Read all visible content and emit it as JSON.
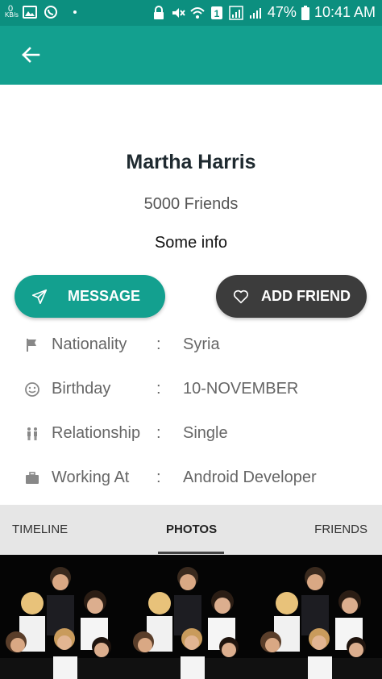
{
  "status_bar": {
    "kbs_top": "0",
    "kbs_bottom": "KB/s",
    "battery": "47%",
    "time": "10:41 AM",
    "icons": [
      "image-icon",
      "whatsapp-icon",
      "dot-icon",
      "lock-icon",
      "mute-icon",
      "wifi-icon",
      "sim-icon",
      "signal-icon",
      "battery-icon"
    ]
  },
  "app_bar": {
    "back_icon": "arrow-left-icon",
    "color": "#13a08f",
    "status_color": "#0c8f7f"
  },
  "profile": {
    "name": "Martha Harris",
    "friends": "5000 Friends",
    "info": "Some info"
  },
  "buttons": {
    "message": "MESSAGE",
    "add_friend": "ADD FRIEND"
  },
  "details": [
    {
      "icon": "flag-icon",
      "label": "Nationality",
      "colon": ":",
      "value": "Syria"
    },
    {
      "icon": "smiley-icon",
      "label": "Birthday",
      "colon": ":",
      "value": "10-NOVEMBER"
    },
    {
      "icon": "couple-icon",
      "label": "Relationship",
      "colon": ":",
      "value": "Single"
    },
    {
      "icon": "briefcase-icon",
      "label": "Working At",
      "colon": ":",
      "value": "Android Developer"
    }
  ],
  "tabs": [
    {
      "label": "TIMELINE"
    },
    {
      "label": "PHOTOS",
      "selected": true
    },
    {
      "label": "FRIENDS"
    }
  ],
  "photos": [
    "group-photo",
    "group-photo",
    "group-photo"
  ]
}
